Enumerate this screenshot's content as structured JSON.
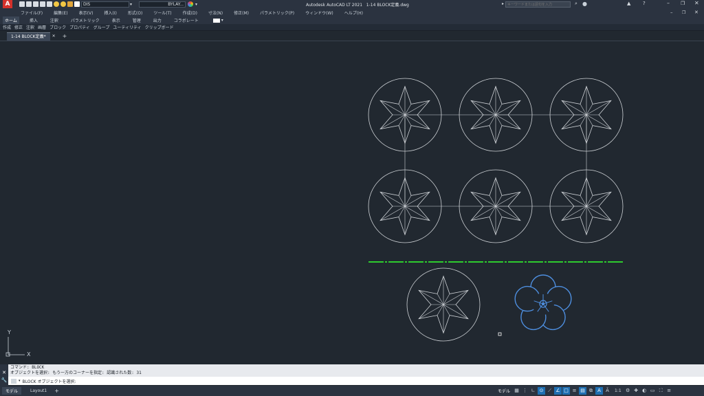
{
  "app": {
    "title": "Autodesk AutoCAD LT 2021",
    "filename": "1-14 BLOCK定義.dwg",
    "search_placeholder": "キーワードまたは語句を入力",
    "accent": "#d4312b"
  },
  "quick_access": {
    "layer_value": "DIS",
    "linetype_value": "BYLAY..."
  },
  "menu": [
    "ファイル(F)",
    "編集(E)",
    "表示(V)",
    "挿入(I)",
    "形式(O)",
    "ツール(T)",
    "作成(D)",
    "寸法(N)",
    "修正(M)",
    "パラメトリック(P)",
    "ウィンドウ(W)",
    "ヘルプ(H)"
  ],
  "ribbon_tabs": [
    "ホーム",
    "挿入",
    "注釈",
    "パラメトリック",
    "表示",
    "管理",
    "出力",
    "コラボレート"
  ],
  "panels": [
    "作成",
    "修正",
    "注釈",
    "画層",
    "ブロック",
    "プロパティ",
    "グループ",
    "ユーティリティ",
    "クリップボード"
  ],
  "file_tab": {
    "label": "1-14 BLOCK定義*",
    "add": "+"
  },
  "drawing": {
    "line_color": "#d0d4d8",
    "divider_color": "#2ecc2e",
    "flower_color": "#4e8fe0"
  },
  "ucs": {
    "x": "X",
    "y": "Y"
  },
  "command": {
    "history": [
      "コマンド: BLOCK",
      "オブジェクトを選択: もう一方のコーナーを指定: 認識された数: 31"
    ],
    "prompt": "BLOCK オブジェクトを選択:"
  },
  "layout_tabs": [
    "モデル",
    "Layout1"
  ],
  "status": {
    "model_label": "モデル",
    "scale": "1:1"
  }
}
